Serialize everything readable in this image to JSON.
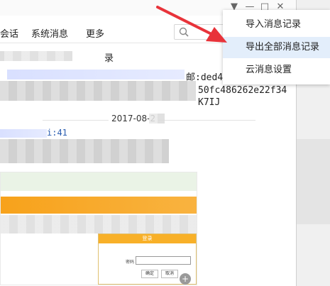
{
  "window": {
    "controls": [
      "▼",
      "—",
      "□",
      "✕"
    ],
    "tabs": [
      "会话",
      "系统消息",
      "更多"
    ],
    "search": {
      "placeholder": ""
    }
  },
  "messages": {
    "partial_line_1": "录",
    "partial_line_2": "邮:ded4",
    "partial_line_3": "50fc486262e22f34",
    "partial_line_4": "K7IJ",
    "partial_line_5": "i:41",
    "date_separator": "2017-08-2"
  },
  "embedded_screenshot": {
    "dialog_title": "登录",
    "dialog_label": "密码",
    "dialog_ok": "确定",
    "dialog_cancel": "取消"
  },
  "dropdown_menu": {
    "items": [
      "导入消息记录",
      "导出全部消息记录",
      "云消息设置"
    ],
    "selected_index": 1
  },
  "colors": {
    "menu_highlight": "#e3eefb",
    "arrow": "#e8333a",
    "orange_banner": "#f7a21b"
  },
  "icons": [
    "search-icon",
    "zoom-icon",
    "red-arrow-icon"
  ]
}
